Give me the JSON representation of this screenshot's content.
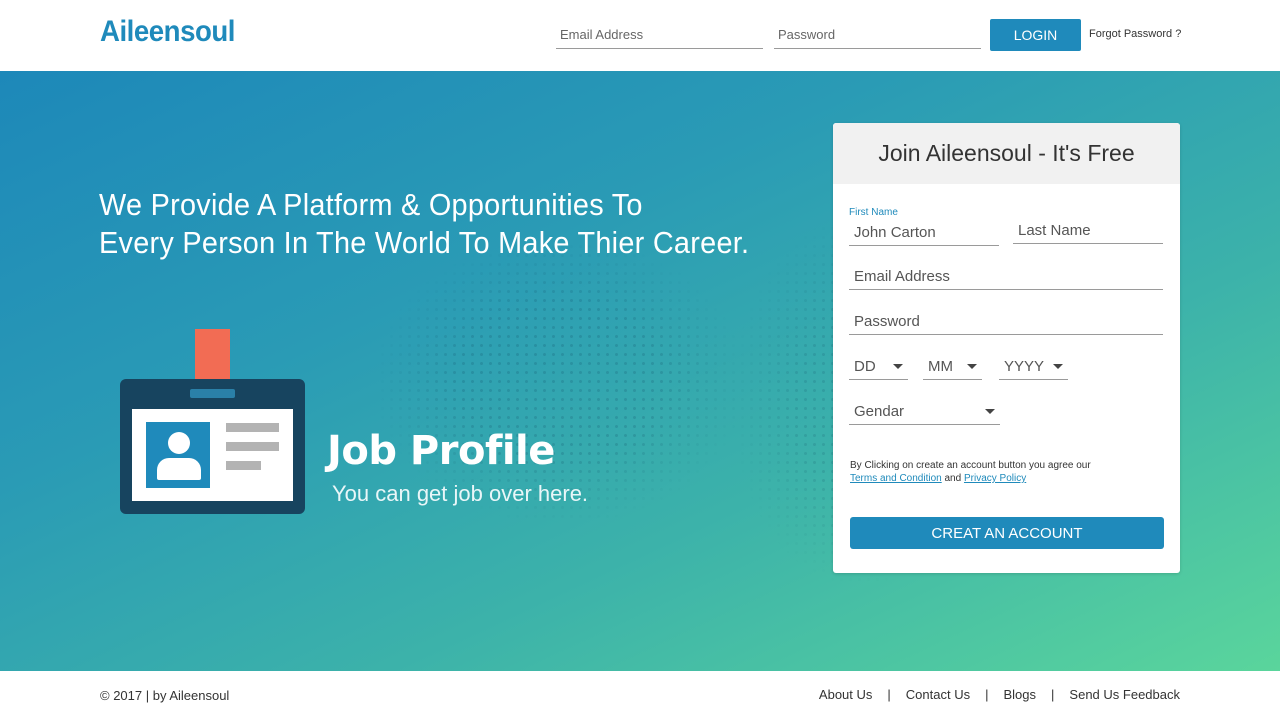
{
  "header": {
    "logo": "Aileensoul",
    "email_placeholder": "Email Address",
    "password_placeholder": "Password",
    "login_label": "LOGIN",
    "forgot_label": "Forgot Password ?"
  },
  "hero": {
    "headline_line1": "We Provide A Platform & Opportunities To",
    "headline_line2": "Every Person In The World To Make Thier Career.",
    "feature_title": "Job Profile",
    "feature_subtitle": "You can get job over here."
  },
  "signup": {
    "title": "Join Aileensoul - It's Free",
    "first_name_label": "First Name",
    "first_name_value": "John Carton",
    "last_name_placeholder": "Last Name",
    "email_placeholder": "Email Address",
    "password_placeholder": "Password",
    "day_selected": "DD",
    "month_selected": "MM",
    "year_selected": "YYYY",
    "gender_selected": "Gendar",
    "terms_text": "By Clicking on create an account button you agree our",
    "terms_link": "Terms and Condition",
    "terms_and": "and",
    "privacy_link": "Privacy Policy",
    "create_label": "CREAT AN ACCOUNT"
  },
  "footer": {
    "copyright": "© 2017 | by Aileensoul",
    "links": [
      "About Us",
      "Contact Us",
      "Blogs",
      "Send Us Feedback"
    ],
    "separator": "|"
  },
  "colors": {
    "brand": "#1f8abb",
    "accent": "#f26c54",
    "gradient_end": "#5ad59c"
  }
}
